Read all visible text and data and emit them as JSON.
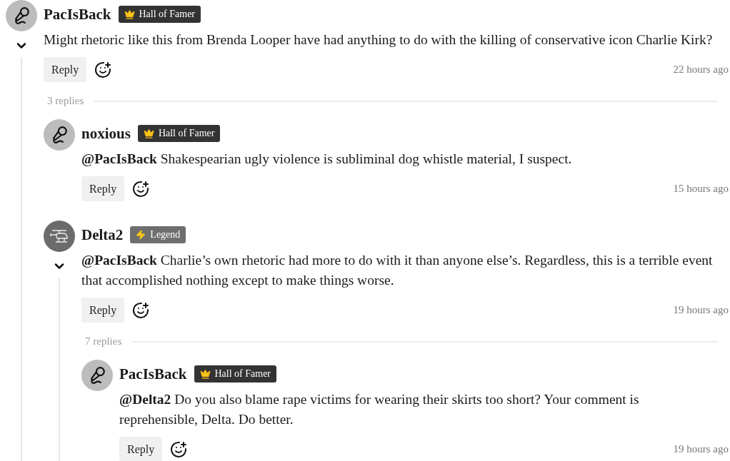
{
  "comments": [
    {
      "author": "PacIsBack",
      "avatar": {
        "kind": "microphone"
      },
      "badge": {
        "kind": "hall_of_famer",
        "label": "Hall of Famer"
      },
      "body": "Might rhetoric like this from Brenda Looper have had anything to do with the killing of conservative icon Charlie Kirk?",
      "reply_label": "Reply",
      "time": "22 hours ago",
      "expanded": true,
      "replies_label": "3 replies",
      "replies": [
        {
          "author": "noxious",
          "avatar": {
            "kind": "microphone"
          },
          "badge": {
            "kind": "hall_of_famer",
            "label": "Hall of Famer"
          },
          "body": "**@PacIsBack** Shakespearian ugly violence is subliminal dog whistle material, I suspect.",
          "reply_label": "Reply",
          "time": "15 hours ago"
        },
        {
          "author": "Delta2",
          "avatar": {
            "kind": "helicopter"
          },
          "badge": {
            "kind": "legend",
            "label": "Legend"
          },
          "body": "**@PacIsBack** Charlie’s own rhetoric had more to do with it than anyone else’s. Regardless, this is a terrible event that accomplished nothing except to make things worse.",
          "reply_label": "Reply",
          "time": "19 hours ago",
          "expanded": true,
          "replies_label": "7 replies",
          "replies": [
            {
              "author": "PacIsBack",
              "avatar": {
                "kind": "microphone"
              },
              "badge": {
                "kind": "hall_of_famer",
                "label": "Hall of Famer"
              },
              "body": "**@Delta2** Do you also blame rape victims for wearing their skirts too short? Your comment is reprehensible, Delta. Do better.",
              "reply_label": "Reply",
              "time": "19 hours ago"
            }
          ]
        }
      ]
    }
  ]
}
